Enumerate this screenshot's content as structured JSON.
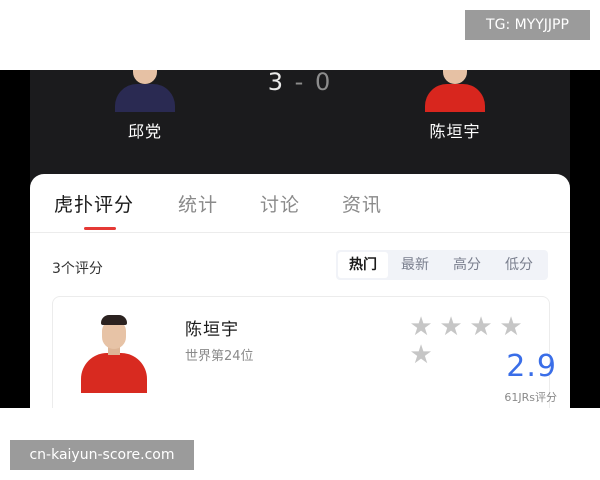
{
  "watermarks": {
    "top": "TG: MYYJJPP",
    "bottom": "cn-kaiyun-score.com"
  },
  "match": {
    "home_player": "邱党",
    "away_player": "陈垣宇",
    "score_home": "3",
    "score_sep": "-",
    "score_away": "0"
  },
  "tabs": [
    {
      "label": "虎扑评分",
      "active": true
    },
    {
      "label": "统计",
      "active": false
    },
    {
      "label": "讨论",
      "active": false
    },
    {
      "label": "资讯",
      "active": false
    }
  ],
  "ratings": {
    "count_label": "3个评分",
    "sort_options": [
      {
        "label": "热门",
        "active": true
      },
      {
        "label": "最新",
        "active": false
      },
      {
        "label": "高分",
        "active": false
      },
      {
        "label": "低分",
        "active": false
      }
    ]
  },
  "rating_card": {
    "name": "陈垣宇",
    "rank": "世界第24位",
    "stars_filled": 0,
    "stars_total": 5,
    "score": "2.9",
    "votes": "61JRs评分"
  },
  "colors": {
    "accent_red": "#e53935",
    "score_blue": "#3a6ee8",
    "star_grey": "#c6c6c6",
    "dark_bg": "#1b1b1d"
  },
  "icons": {
    "star": "star-icon"
  }
}
